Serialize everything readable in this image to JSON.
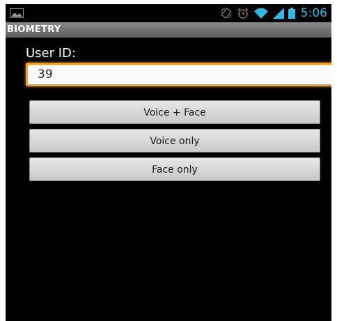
{
  "status_bar": {
    "time": "5:06",
    "icons": [
      "gallery-icon",
      "screen-rotation-icon",
      "alarm-icon",
      "wifi-icon",
      "signal-icon",
      "battery-icon"
    ],
    "accent_color": "#33b5e5"
  },
  "app": {
    "title": "BIOMETRY"
  },
  "form": {
    "user_id_label": "User ID:",
    "user_id_value": "39",
    "focus_color": "#f2a02a"
  },
  "buttons": {
    "voice_face": "Voice + Face",
    "voice_only": "Voice only",
    "face_only": "Face only"
  }
}
